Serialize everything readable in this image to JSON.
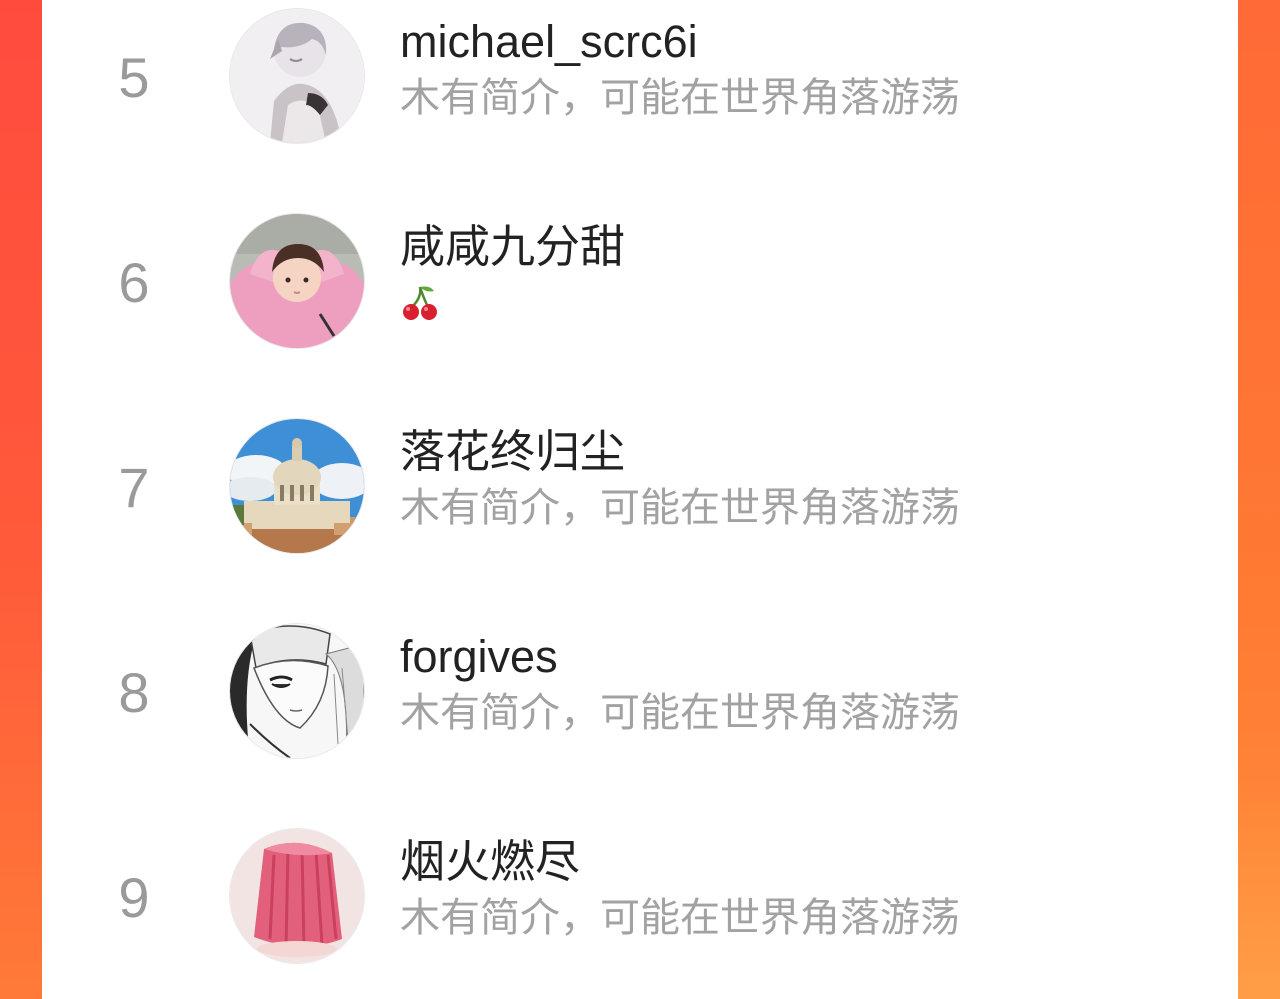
{
  "colors": {
    "background_accent": "#ff5a3a",
    "rank_text": "#9a9a9a",
    "name_text": "#222222",
    "bio_text": "#a2a2a2"
  },
  "users": [
    {
      "rank": "5",
      "name": "michael_scrc6i",
      "bio": "木有简介，可能在世界角落游荡",
      "avatar": "anime-boy-avatar"
    },
    {
      "rank": "6",
      "name": "咸咸九分甜",
      "bio": "",
      "bio_icon": "cherry-emoji",
      "avatar": "child-photo-avatar"
    },
    {
      "rank": "7",
      "name": "落花终归尘",
      "bio": "木有简介，可能在世界角落游荡",
      "avatar": "domed-building-avatar"
    },
    {
      "rank": "8",
      "name": "forgives",
      "bio": "木有简介，可能在世界角落游荡",
      "avatar": "manga-girl-avatar"
    },
    {
      "rank": "9",
      "name": "烟火燃尽",
      "bio": "木有简介，可能在世界角落游荡",
      "avatar": "pink-skirt-avatar"
    }
  ]
}
